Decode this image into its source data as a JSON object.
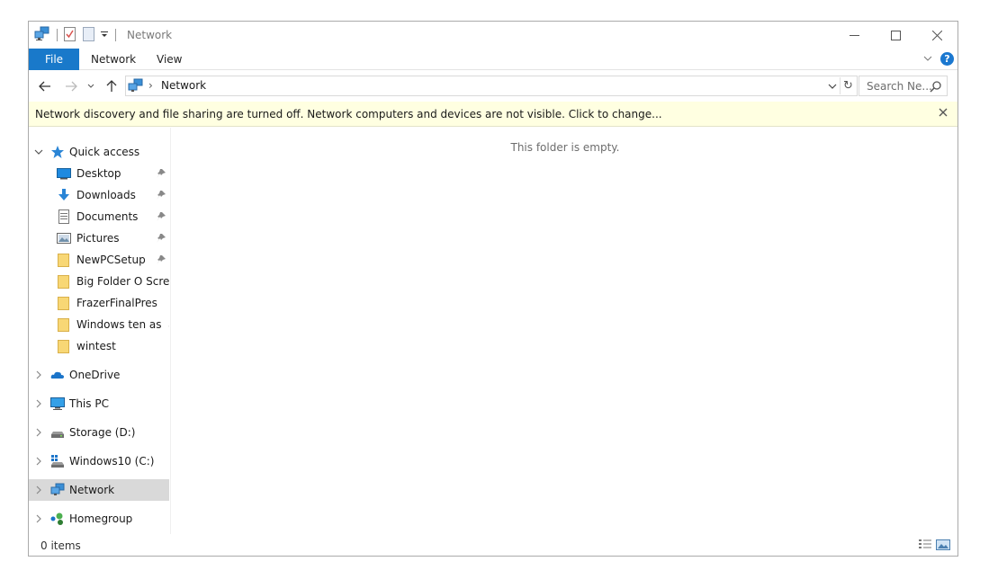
{
  "window": {
    "title": "Network"
  },
  "ribbon": {
    "tabs": [
      {
        "label": "File"
      },
      {
        "label": "Network"
      },
      {
        "label": "View"
      }
    ],
    "help": "?"
  },
  "address": {
    "location": "Network",
    "search_placeholder": "Search Ne..."
  },
  "infobar": {
    "message": "Network discovery and file sharing are turned off. Network computers and devices are not visible. Click to change...",
    "close": "x"
  },
  "navpane": {
    "quick_access": {
      "label": "Quick access"
    },
    "quick_items": [
      {
        "label": "Desktop",
        "icon": "desktop-icon",
        "pinned": true
      },
      {
        "label": "Downloads",
        "icon": "downloads-icon",
        "pinned": true
      },
      {
        "label": "Documents",
        "icon": "documents-icon",
        "pinned": true
      },
      {
        "label": "Pictures",
        "icon": "pictures-icon",
        "pinned": true
      },
      {
        "label": "NewPCSetup",
        "icon": "folder-icon",
        "pinned": true
      },
      {
        "label": "Big Folder O Screen",
        "icon": "folder-icon",
        "pinned": false
      },
      {
        "label": "FrazerFinalPres",
        "icon": "folder-icon",
        "pinned": false
      },
      {
        "label": "Windows ten as  a s",
        "icon": "folder-icon",
        "pinned": false
      },
      {
        "label": "wintest",
        "icon": "folder-icon",
        "pinned": false
      }
    ],
    "roots": [
      {
        "label": "OneDrive",
        "icon": "onedrive-icon"
      },
      {
        "label": "This PC",
        "icon": "this-pc-icon"
      },
      {
        "label": "Storage (D:)",
        "icon": "drive-icon"
      },
      {
        "label": "Windows10 (C:)",
        "icon": "windows-drive-icon"
      },
      {
        "label": "Network",
        "icon": "network-icon",
        "selected": true
      },
      {
        "label": "Homegroup",
        "icon": "homegroup-icon"
      }
    ]
  },
  "content": {
    "empty_message": "This folder is empty."
  },
  "status": {
    "item_count": "0 items"
  },
  "colors": {
    "accent": "#1979ca",
    "infobar_bg": "#ffffe1",
    "selected_bg": "#d9d9d9",
    "folder": "#f8d775"
  }
}
